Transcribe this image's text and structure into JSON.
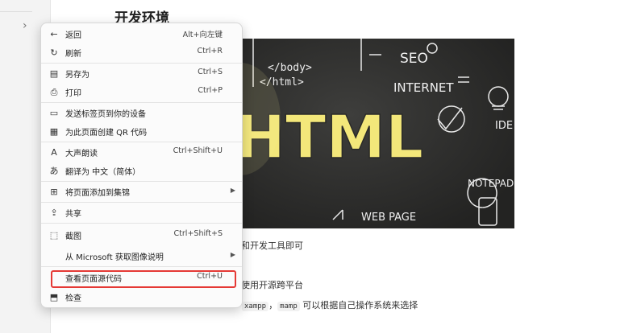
{
  "page": {
    "heading": "开发环境",
    "line1_suffix": "和开发工具即可",
    "line2_suffix": "使用开源跨平台",
    "line3": {
      "chip1": "xampp",
      "sep": "，",
      "chip2": "mamp",
      "text": " 可以根据自己操作系统来选择"
    }
  },
  "hero": {
    "words": [
      "</body>",
      "</html>",
      "SEO",
      "INTERNET",
      "HTML",
      "IDE",
      "NOTEPAD",
      "WEB PAGE"
    ]
  },
  "context_menu": {
    "items": [
      {
        "icon": "back-arrow-icon",
        "glyph": "←",
        "label": "返回",
        "shortcut": "Alt+向左键"
      },
      {
        "icon": "refresh-icon",
        "glyph": "↻",
        "label": "刷新",
        "shortcut": "Ctrl+R"
      },
      {
        "icon": "save-as-icon",
        "glyph": "▤",
        "label": "另存为",
        "shortcut": "Ctrl+S"
      },
      {
        "icon": "print-icon",
        "glyph": "⎙",
        "label": "打印",
        "shortcut": "Ctrl+P"
      },
      {
        "icon": "send-to-device-icon",
        "glyph": "▭",
        "label": "发送标签页到你的设备",
        "shortcut": ""
      },
      {
        "icon": "qr-code-icon",
        "glyph": "▦",
        "label": "为此页面创建 QR 代码",
        "shortcut": ""
      },
      {
        "icon": "read-aloud-icon",
        "glyph": "A",
        "label": "大声朗读",
        "shortcut": "Ctrl+Shift+U"
      },
      {
        "icon": "translate-icon",
        "glyph": "あ",
        "label": "翻译为 中文（简体）",
        "shortcut": ""
      },
      {
        "icon": "collections-icon",
        "glyph": "⊞",
        "label": "将页面添加到集锦",
        "shortcut": "",
        "submenu": true
      },
      {
        "icon": "share-icon",
        "glyph": "⇪",
        "label": "共享",
        "shortcut": ""
      },
      {
        "icon": "screenshot-icon",
        "glyph": "⬚",
        "label": "截图",
        "shortcut": "Ctrl+Shift+S"
      },
      {
        "icon": "",
        "glyph": "",
        "label": "从 Microsoft 获取图像说明",
        "shortcut": "",
        "submenu": true
      },
      {
        "icon": "",
        "glyph": "",
        "label": "查看页面源代码",
        "shortcut": "Ctrl+U"
      },
      {
        "icon": "inspect-icon",
        "glyph": "⬒",
        "label": "检查",
        "shortcut": ""
      }
    ]
  },
  "colors": {
    "highlight": "#e53935",
    "hero_bg": "#2d2d2b",
    "html_text": "#f3e77a"
  }
}
